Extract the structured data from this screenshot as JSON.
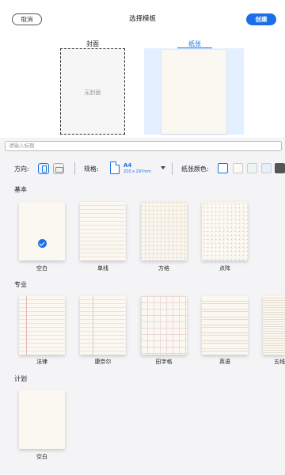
{
  "header": {
    "cancel_label": "取消",
    "title": "选择模板",
    "create_label": "创建"
  },
  "preview": {
    "cover_label": "封面",
    "no_cover_text": "无封面",
    "paper_label": "纸张"
  },
  "title_input": {
    "placeholder": "请输入标题"
  },
  "options": {
    "orientation_label": "方向:",
    "spec_label": "规格:",
    "size_name": "A4",
    "size_dims": "210 x 297mm",
    "paper_color_label": "纸张颜色:",
    "colors": [
      "#ffffff",
      "#fbfaf4",
      "#eaf6ee",
      "#e6eef8",
      "#555555"
    ]
  },
  "sections": {
    "basic": {
      "label": "基本",
      "items": [
        "空白",
        "单线",
        "方格",
        "点阵"
      ]
    },
    "professional": {
      "label": "专业",
      "items": [
        "法律",
        "康奈尔",
        "田字格",
        "英语",
        "五线"
      ]
    },
    "plan": {
      "label": "计划",
      "items": [
        "空白"
      ]
    }
  },
  "colors": {
    "accent": "#1a6fe8",
    "paper": "#fbf8f1"
  }
}
